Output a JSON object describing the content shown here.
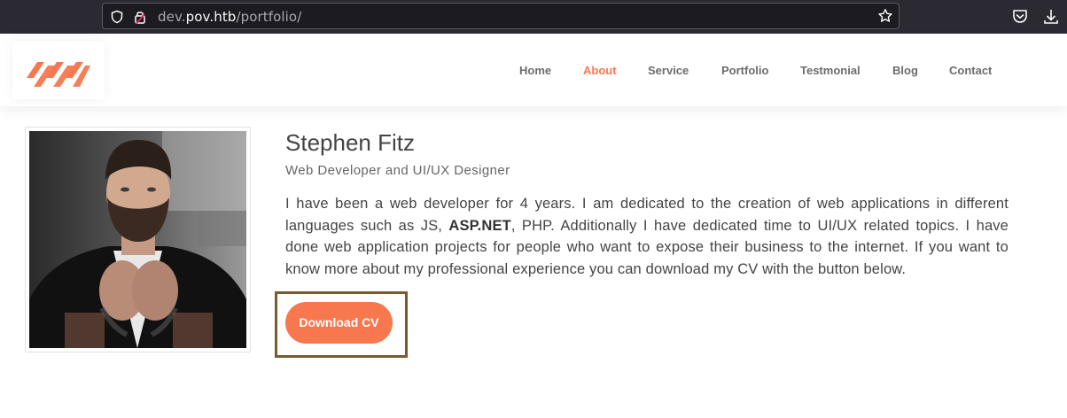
{
  "browser": {
    "url_prefix": "dev.",
    "url_domain": "pov.htb",
    "url_path": "/portfolio/"
  },
  "nav": {
    "items": [
      "Home",
      "About",
      "Service",
      "Portfolio",
      "Testmonial",
      "Blog",
      "Contact"
    ],
    "active": "About"
  },
  "profile": {
    "name": "Stephen Fitz",
    "title": "Web Developer and UI/UX Designer",
    "bio_part1": "I have been a web developer for 4 years. I am dedicated to the creation of web applications in different languages such as JS, ",
    "bio_bold": "ASP.NET",
    "bio_part2": ", PHP. Additionally I have dedicated time to UI/UX related topics. I have done web application projects for people who want to expose their business to the internet. If you want to know more about my professional experience you can download my CV with the button below.",
    "button_label": "Download CV"
  },
  "colors": {
    "accent": "#f7784f",
    "browser_bg": "#2b2a33",
    "highlight_box": "#7a5a2e"
  }
}
